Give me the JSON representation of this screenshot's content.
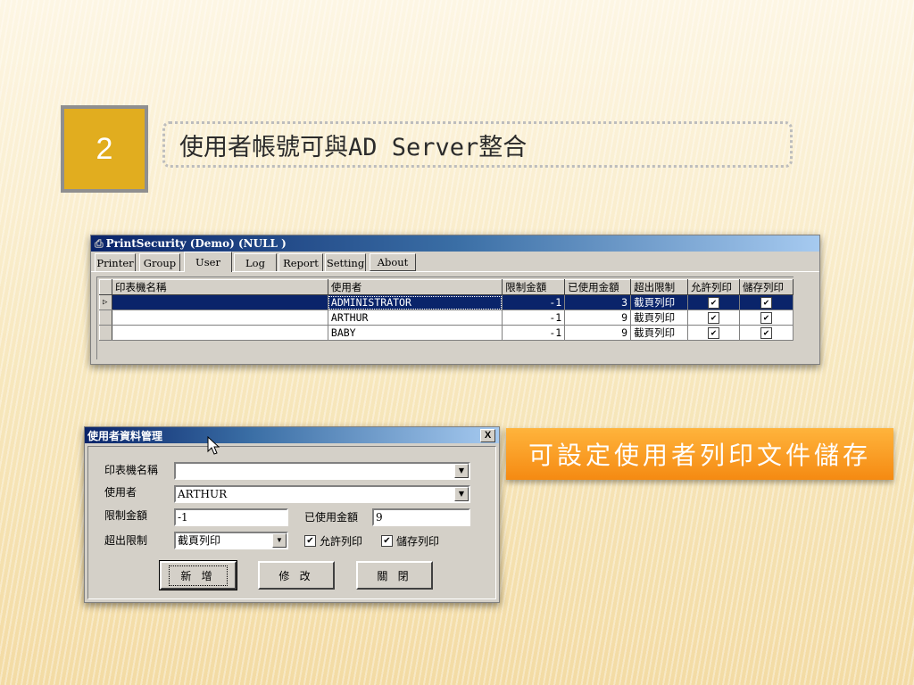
{
  "slide": {
    "number": "2",
    "title": "使用者帳號可與AD Server整合",
    "callout": "可設定使用者列印文件儲存"
  },
  "app_window": {
    "title": "PrintSecurity (Demo) (NULL )",
    "tabs": [
      "Printer",
      "Group",
      "User",
      "Log",
      "Report",
      "Setting",
      "About"
    ],
    "active_tab": "User",
    "columns": [
      "印表機名稱",
      "使用者",
      "限制金額",
      "已使用金額",
      "超出限制",
      "允許列印",
      "儲存列印"
    ],
    "rows": [
      {
        "printer": "",
        "user": "ADMINISTRATOR",
        "limit": "-1",
        "used": "3",
        "exceed": "截頁列印",
        "allow": true,
        "store": true
      },
      {
        "printer": "",
        "user": "ARTHUR",
        "limit": "-1",
        "used": "9",
        "exceed": "截頁列印",
        "allow": true,
        "store": true
      },
      {
        "printer": "",
        "user": "BABY",
        "limit": "-1",
        "used": "9",
        "exceed": "截頁列印",
        "allow": true,
        "store": true
      }
    ]
  },
  "dialog": {
    "title": "使用者資料管理",
    "close_label": "X",
    "printer_label": "印表機名稱",
    "printer_value": "",
    "user_label": "使用者",
    "user_value": "ARTHUR",
    "limit_label": "限制金額",
    "limit_value": "-1",
    "used_label": "已使用金額",
    "used_value": "9",
    "exceed_label": "超出限制",
    "exceed_value": "截頁列印",
    "allow_label": "允許列印",
    "store_label": "儲存列印",
    "buttons": [
      "新 增",
      "修 改",
      "關 閉"
    ]
  },
  "icons": {
    "app": "printer-icon",
    "dropdown": "chevron-down-icon",
    "cursor": "mouse-pointer-icon"
  },
  "colors": {
    "badge": "#e1ad1f",
    "callout": "#f58a12",
    "selection": "#0a246a"
  }
}
